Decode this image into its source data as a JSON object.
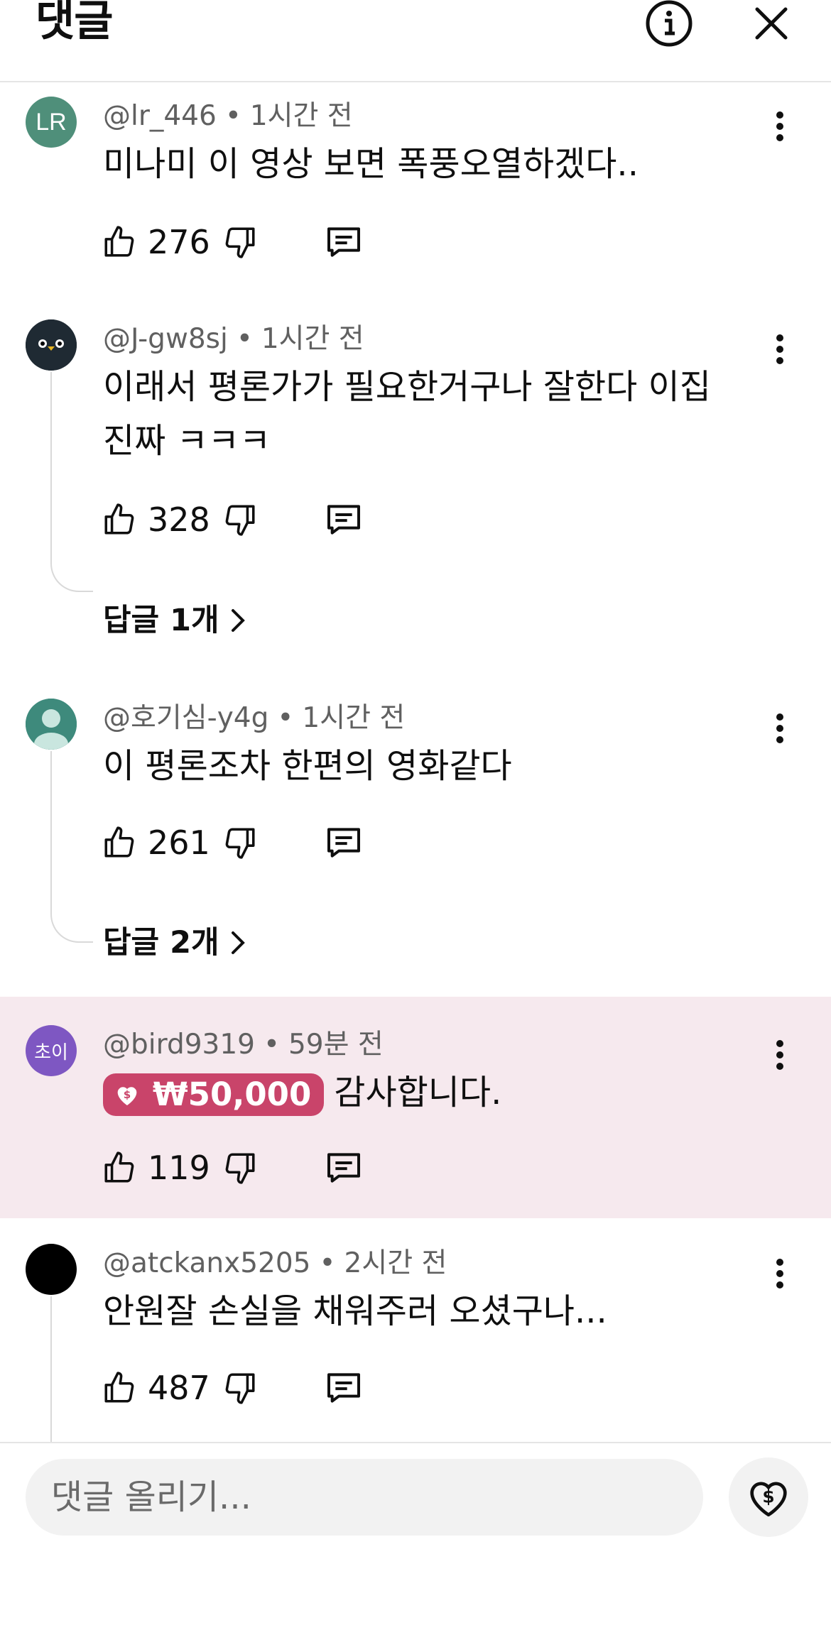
{
  "header": {
    "title": "댓글"
  },
  "comments": [
    {
      "author": "@lr_446",
      "time": "1시간 전",
      "avatar_text": "LR",
      "avatar_color": "#4f8f7a",
      "text": "미나미 이 영상 보면 폭풍오열하겠다..",
      "likes": "276"
    },
    {
      "author": "@J-gw8sj",
      "time": "1시간 전",
      "avatar_color": "#1f2a33",
      "text": "이래서 평론가가 필요한거구나 잘한다 이집 진짜 ㅋㅋㅋ",
      "likes": "328",
      "replies_label": "답글 1개"
    },
    {
      "author": "@호기심-y4g",
      "time": "1시간 전",
      "avatar_color": "#3e8a7c",
      "text": "이 평론조차 한편의 영화같다",
      "likes": "261",
      "replies_label": "답글 2개"
    },
    {
      "author": "@bird9319",
      "time": "59분 전",
      "avatar_text": "초이",
      "avatar_color": "#7e57c2",
      "donation_amount": "₩50,000",
      "donation_color": "#c9446a",
      "text": "감사합니다.",
      "likes": "119"
    },
    {
      "author": "@atckanx5205",
      "time": "2시간 전",
      "avatar_color": "#000000",
      "text": "안원잘 손실을 채워주러 오셨구나...",
      "likes": "487"
    }
  ],
  "composer": {
    "placeholder": "댓글 올리기..."
  },
  "meta_separator": "•",
  "icons": {
    "info": "info-icon",
    "close": "close-icon",
    "more": "more-vert-icon",
    "like": "thumb-up-icon",
    "dislike": "thumb-down-icon",
    "reply": "reply-icon",
    "chevron": "chevron-right-icon",
    "thanks": "super-thanks-icon"
  }
}
